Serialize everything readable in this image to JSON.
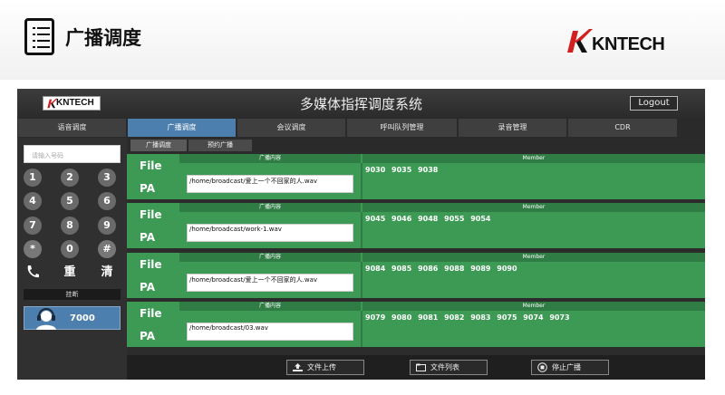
{
  "banner": {
    "title": "广播调度",
    "brand": "KNTECH"
  },
  "app": {
    "logo": "KNTECH",
    "title": "多媒体指挥调度系统",
    "logout_label": "Logout",
    "nav_tabs": [
      "语音调度",
      "广播调度",
      "会议调度",
      "呼叫队列管理",
      "录音管理",
      "CDR"
    ],
    "active_tab": "广播调度",
    "sub_tabs": [
      "广播调度",
      "预约广播"
    ],
    "active_sub_tab": "广播调度"
  },
  "dialer": {
    "placeholder": "请输入号码",
    "keys": [
      "1",
      "2",
      "3",
      "4",
      "5",
      "6",
      "7",
      "8",
      "9",
      "*",
      "0",
      "#"
    ],
    "call_label": "重",
    "clear_label": "清",
    "hangup_label": "挂断",
    "operator_ext": "7000"
  },
  "broadcast": {
    "file_label": "File",
    "pa_label": "PA",
    "content_header": "广播内容",
    "member_header": "Member",
    "rows": [
      {
        "file": "/home/broadcast/爱上一个不回家的人.wav",
        "members": "9030 9035 9038"
      },
      {
        "file": "/home/broadcast/work-1.wav",
        "members": "9045 9046 9048 9055 9054"
      },
      {
        "file": "/home/broadcast/爱上一个不回家的人.wav",
        "members": "9084 9085 9086 9088 9089 9090"
      },
      {
        "file": "/home/broadcast/03.wav",
        "members": "9079 9080 9081 9082 9083 9075 9074 9073"
      }
    ]
  },
  "footer": {
    "upload_label": "文件上传",
    "list_label": "文件列表",
    "stop_label": "停止广播"
  },
  "colors": {
    "accent": "#4d7fae",
    "green": "#3c9a54",
    "dark_green": "#2f7d44",
    "panel": "#2c2c2c"
  }
}
